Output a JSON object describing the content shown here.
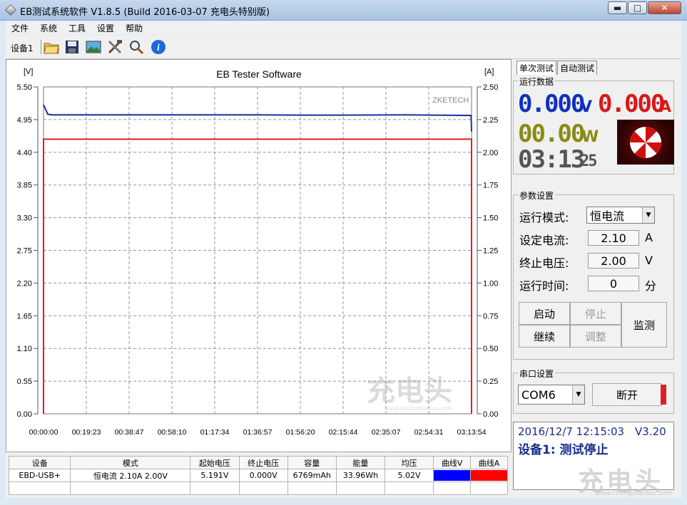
{
  "window": {
    "title": "EB测试系统软件 V1.8.5 (Build 2016-03-07 充电头特别版)",
    "minimize": "▬",
    "maximize": "□",
    "close": "✕"
  },
  "menu": [
    "文件",
    "系统",
    "工具",
    "设置",
    "帮助"
  ],
  "toolbar": {
    "device_tab": "设备1",
    "icons": [
      "folder-icon",
      "save-icon",
      "image-icon",
      "tools-icon",
      "zoom-icon",
      "info-icon"
    ]
  },
  "chart_data": {
    "type": "line",
    "title": "EB Tester Software",
    "watermark": "ZKETECH",
    "y_left_unit": "[V]",
    "y_right_unit": "[A]",
    "y_left_ticks": [
      "5.50",
      "4.95",
      "4.40",
      "3.85",
      "3.30",
      "2.75",
      "2.20",
      "1.65",
      "1.10",
      "0.55",
      "0.00"
    ],
    "y_right_ticks": [
      "2.50",
      "2.25",
      "2.00",
      "1.75",
      "1.50",
      "1.25",
      "1.00",
      "0.75",
      "0.50",
      "0.25",
      "0.00"
    ],
    "x_ticks": [
      "00:00:00",
      "00:19:23",
      "00:38:47",
      "00:58:10",
      "01:17:34",
      "01:36:57",
      "01:56:20",
      "02:15:44",
      "02:35:07",
      "02:54:31",
      "03:13:54"
    ],
    "ylim_left": [
      0,
      5.5
    ],
    "ylim_right": [
      0,
      2.5
    ],
    "grid": true,
    "series": [
      {
        "axis": "left",
        "color": "#1c2f9b",
        "x": [
          0,
          0.01,
          0.02,
          0.3,
          0.5,
          0.6,
          0.7,
          0.85,
          0.999,
          1.0
        ],
        "y": [
          5.2,
          5.04,
          5.03,
          5.03,
          5.03,
          5.025,
          5.025,
          5.03,
          5.02,
          4.75
        ]
      },
      {
        "axis": "right",
        "color": "#dd2020",
        "x": [
          0,
          0,
          1.0,
          1.0
        ],
        "y": [
          0,
          2.1,
          2.1,
          0
        ]
      }
    ]
  },
  "table": {
    "headers": [
      "设备",
      "模式",
      "起始电压",
      "终止电压",
      "容量",
      "能量",
      "均压",
      "曲线V",
      "曲线A"
    ],
    "rows": [
      [
        "EBD-USB+",
        "恒电流  2.10A  2.00V",
        "5.191V",
        "0.000V",
        "6769mAh",
        "33.96Wh",
        "5.02V",
        "",
        ""
      ]
    ],
    "curve_v_color": "#0000ff",
    "curve_a_color": "#ff0000"
  },
  "right_panel": {
    "tabs": [
      "单次测试",
      "自动测试"
    ],
    "run_data": {
      "title": "运行数据",
      "voltage": "0.000",
      "voltage_unit": "V",
      "current": "0.000",
      "current_unit": "A",
      "power": "00.00",
      "power_unit": "W",
      "time_hm": "03:13",
      "time_s": "25",
      "voltage_color": "#1030c0",
      "current_color": "#d81818",
      "power_color": "#8a8a14"
    },
    "params": {
      "title": "参数设置",
      "mode_label": "运行模式:",
      "mode_value": "恒电流",
      "current_label": "设定电流:",
      "current_value": "2.10",
      "current_unit": "A",
      "voltage_label": "终止电压:",
      "voltage_value": "2.00",
      "voltage_unit": "V",
      "time_label": "运行时间:",
      "time_value": "0",
      "time_unit": "分"
    },
    "buttons": {
      "start": "启动",
      "stop": "停止",
      "monitor": "监测",
      "continue": "继续",
      "adjust": "调整"
    },
    "serial": {
      "title": "串口设置",
      "port": "COM6",
      "disconnect": "断开",
      "indicator_color": "#e02020"
    },
    "status": {
      "datetime": "2016/12/7 12:15:03",
      "version": "V3.20",
      "message": "设备1: 测试停止"
    }
  },
  "watermark": {
    "big": "充电头",
    "small": "www.chongdiantou.com"
  }
}
